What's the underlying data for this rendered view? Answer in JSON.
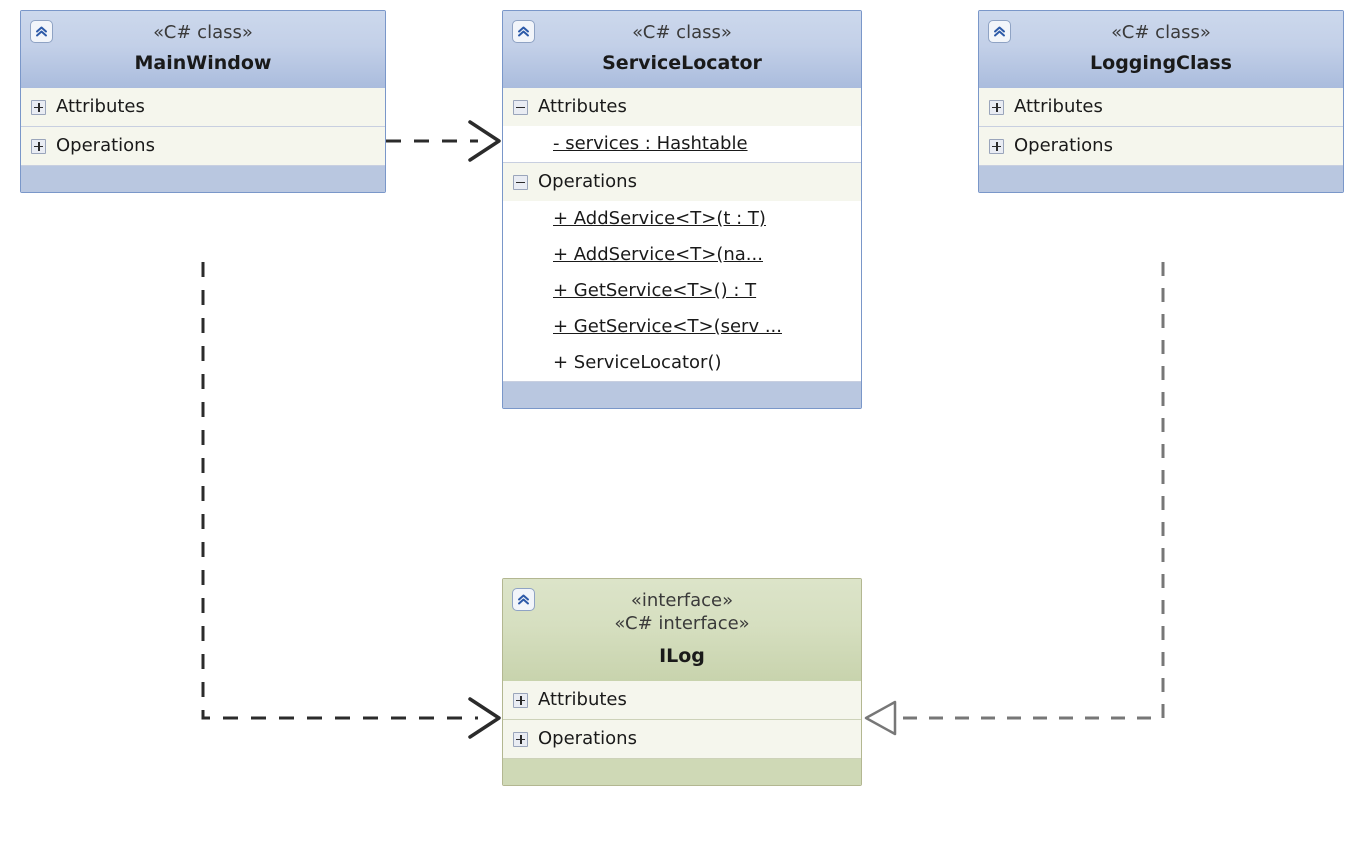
{
  "diagram": {
    "title": "UML class diagram",
    "kind": "uml-class-diagram",
    "background": "#ffffff",
    "palette": {
      "class_header_top": "#ccd8ec",
      "class_header_bottom": "#aabcdd",
      "class_border": "#7a97c9",
      "class_footer": "#b9c7e0",
      "interface_header_top": "#dce4c9",
      "interface_header_bottom": "#c8d3ad",
      "interface_border": "#b3b791",
      "interface_footer": "#cfd9b6",
      "compartment_bg": "#f5f6ed",
      "member_bg": "#ffffff",
      "edge_color": "#3a3a3a",
      "realization_edge_color": "#6e6e6e"
    },
    "nodes": [
      {
        "id": "main-window",
        "stereotypes": [
          "«C# class»"
        ],
        "name": "MainWindow",
        "header_icon": "collapse-chevron-icon",
        "compartments": [
          {
            "label": "Attributes",
            "expander": "plus",
            "members": []
          },
          {
            "label": "Operations",
            "expander": "plus",
            "members": []
          }
        ]
      },
      {
        "id": "service-locator",
        "stereotypes": [
          "«C# class»"
        ],
        "name": "ServiceLocator",
        "header_icon": "collapse-chevron-icon",
        "compartments": [
          {
            "label": "Attributes",
            "expander": "minus",
            "members": [
              {
                "text": "- services : Hashtable",
                "static": true
              }
            ]
          },
          {
            "label": "Operations",
            "expander": "minus",
            "members": [
              {
                "text": "+ AddService<T>(t : T)",
                "static": true
              },
              {
                "text": "+  AddService<T>(na...",
                "static": true
              },
              {
                "text": "+ GetService<T>() : T",
                "static": true
              },
              {
                "text": "+  GetService<T>(serv ...",
                "static": true
              },
              {
                "text": "+ ServiceLocator()",
                "static": false
              }
            ]
          }
        ]
      },
      {
        "id": "logging-class",
        "stereotypes": [
          "«C# class»"
        ],
        "name": "LoggingClass",
        "header_icon": "collapse-chevron-icon",
        "compartments": [
          {
            "label": "Attributes",
            "expander": "plus",
            "members": []
          },
          {
            "label": "Operations",
            "expander": "plus",
            "members": []
          }
        ]
      },
      {
        "id": "ilog",
        "stereotypes": [
          "«interface»",
          "«C# interface»"
        ],
        "name": "ILog",
        "header_icon": "collapse-chevron-icon",
        "compartments": [
          {
            "label": "Attributes",
            "expander": "plus",
            "members": []
          },
          {
            "label": "Operations",
            "expander": "plus",
            "members": []
          }
        ]
      }
    ],
    "edges": [
      {
        "id": "mainwindow-to-servicelocator",
        "from": "MainWindow",
        "to": "ServiceLocator",
        "type": "dependency",
        "line": "dashed",
        "arrowhead": "open-arrow"
      },
      {
        "id": "mainwindow-to-ilog",
        "from": "MainWindow",
        "to": "ILog",
        "type": "dependency",
        "line": "dashed",
        "arrowhead": "open-arrow"
      },
      {
        "id": "loggingclass-to-ilog",
        "from": "LoggingClass",
        "to": "ILog",
        "type": "realization",
        "line": "dashed",
        "arrowhead": "hollow-triangle"
      }
    ]
  }
}
